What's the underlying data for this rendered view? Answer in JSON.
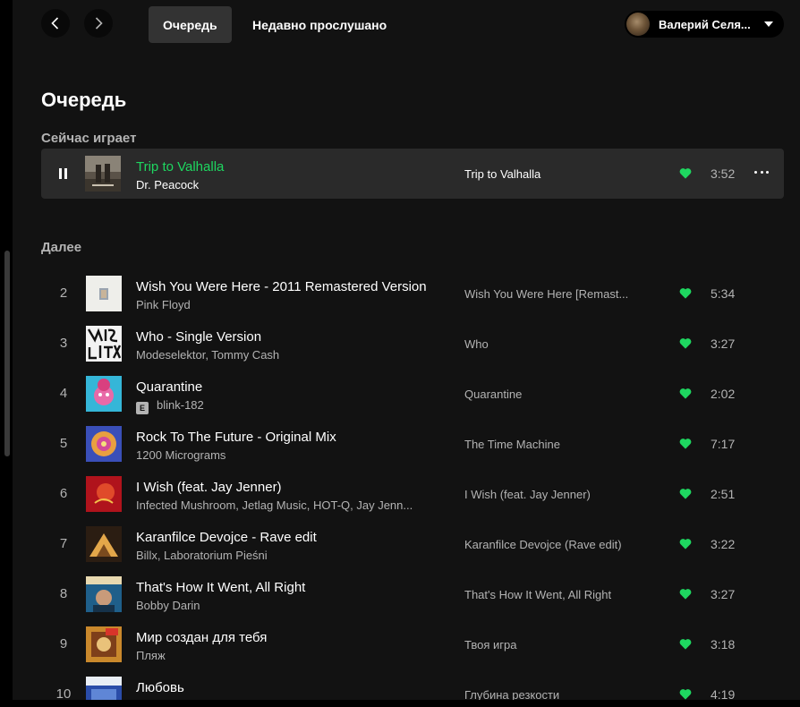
{
  "nav": {
    "back_icon": "chevron-left-icon",
    "forward_icon": "chevron-right-icon",
    "tabs": [
      {
        "label": "Очередь",
        "active": true
      },
      {
        "label": "Недавно прослушано",
        "active": false
      }
    ]
  },
  "user": {
    "name": "Валерий Селя..."
  },
  "page": {
    "title": "Очередь",
    "now_playing_label": "Сейчас играет",
    "next_label": "Далее"
  },
  "colors": {
    "accent": "#1ed760",
    "background": "#121212",
    "row_highlight": "#2a2a2a"
  },
  "now_playing": {
    "title": "Trip to Valhalla",
    "artist": "Dr. Peacock",
    "album": "Trip to Valhalla",
    "duration": "3:52",
    "liked": true
  },
  "tracks": [
    {
      "num": "2",
      "title": "Wish You Were Here - 2011 Remastered Version",
      "artist": "Pink Floyd",
      "album": "Wish You Were Here [Remast...",
      "duration": "5:34",
      "explicit": false
    },
    {
      "num": "3",
      "title": "Who - Single Version",
      "artist": "Modeselektor, Tommy Cash",
      "album": "Who",
      "duration": "3:27",
      "explicit": false
    },
    {
      "num": "4",
      "title": "Quarantine",
      "artist": "blink-182",
      "album": "Quarantine",
      "duration": "2:02",
      "explicit": true,
      "explicit_label": "E"
    },
    {
      "num": "5",
      "title": "Rock To The Future - Original Mix",
      "artist": "1200 Micrograms",
      "album": "The Time Machine",
      "duration": "7:17",
      "explicit": false
    },
    {
      "num": "6",
      "title": "I Wish (feat. Jay Jenner)",
      "artist": "Infected Mushroom, Jetlag Music, HOT-Q, Jay Jenn...",
      "album": "I Wish (feat. Jay Jenner)",
      "duration": "2:51",
      "explicit": false
    },
    {
      "num": "7",
      "title": "Karanfilce Devojce - Rave edit",
      "artist": "Billx, Laboratorium Pieśni",
      "album": "Karanfilce Devojce (Rave edit)",
      "duration": "3:22",
      "explicit": false
    },
    {
      "num": "8",
      "title": "That's How It Went, All Right",
      "artist": "Bobby Darin",
      "album": "That's How It Went, All Right",
      "duration": "3:27",
      "explicit": false
    },
    {
      "num": "9",
      "title": "Мир создан для тебя",
      "artist": "Пляж",
      "album": "Твоя игра",
      "duration": "3:18",
      "explicit": false
    },
    {
      "num": "10",
      "title": "Любовь",
      "artist": "",
      "album": "Глубина резкости",
      "duration": "4:19",
      "explicit": false
    }
  ]
}
